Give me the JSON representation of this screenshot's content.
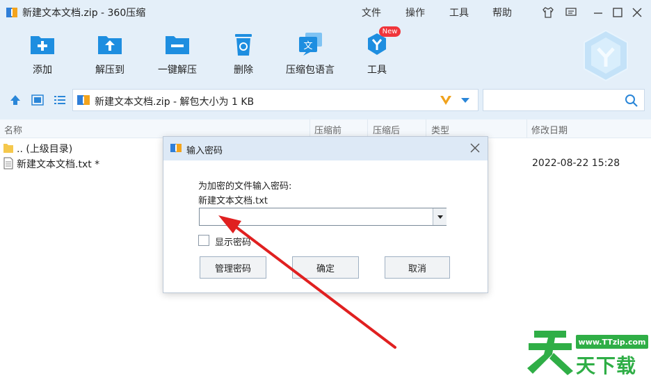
{
  "window": {
    "title": "新建文本文档.zip - 360压缩",
    "menu": [
      "文件",
      "操作",
      "工具",
      "帮助"
    ]
  },
  "toolbar": {
    "items": [
      {
        "label": "添加",
        "icon": "add-folder-icon"
      },
      {
        "label": "解压到",
        "icon": "extract-to-icon"
      },
      {
        "label": "一键解压",
        "icon": "one-click-extract-icon"
      },
      {
        "label": "删除",
        "icon": "delete-icon"
      },
      {
        "label": "压缩包语言",
        "icon": "archive-language-icon"
      },
      {
        "label": "工具",
        "icon": "tools-icon"
      }
    ],
    "new_badge": "New"
  },
  "address": {
    "text": "新建文本文档.zip - 解包大小为 1 KB"
  },
  "file_list": {
    "columns": [
      "名称",
      "压缩前",
      "压缩后",
      "类型",
      "修改日期"
    ],
    "rows": [
      {
        "name": ".. (上级目录)",
        "modified": ""
      },
      {
        "name": "新建文本文档.txt *",
        "modified": "2022-08-22 15:28"
      }
    ]
  },
  "dialog": {
    "title": "输入密码",
    "prompt": "为加密的文件输入密码:",
    "filename": "新建文本文档.txt",
    "password_value": "",
    "show_password_label": "显示密码",
    "buttons": {
      "manage": "管理密码",
      "ok": "确定",
      "cancel": "取消"
    }
  },
  "watermark": {
    "url": "www.TTzip.com",
    "text": "天下载"
  },
  "colors": {
    "accent_blue": "#1e8ee0",
    "header_bg": "#e4eff9",
    "arrow_red": "#e02020",
    "watermark_green": "#2fae46"
  }
}
